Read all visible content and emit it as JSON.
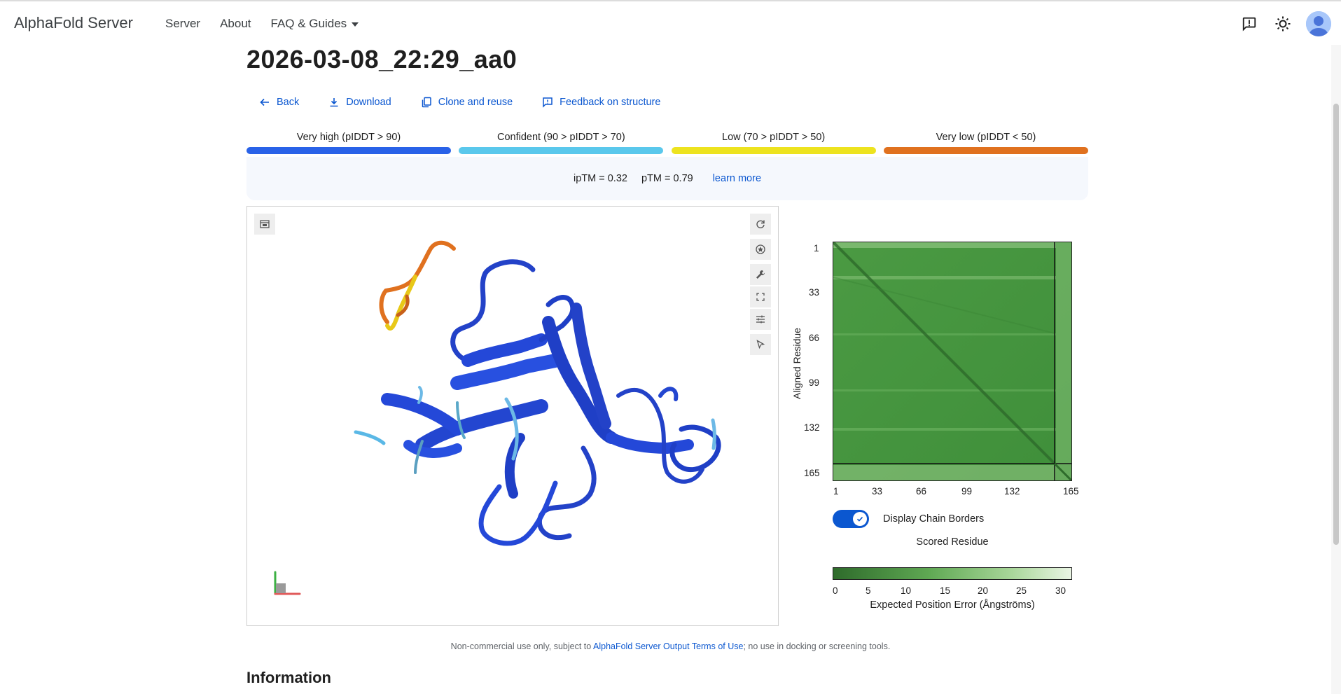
{
  "app": {
    "brand": "AlphaFold Server"
  },
  "nav": {
    "server": "Server",
    "about": "About",
    "faq": "FAQ & Guides"
  },
  "icons": {
    "feedback": "feedback-icon",
    "theme": "brightness-icon",
    "avatar": "account-avatar"
  },
  "page": {
    "title": "2026-03-08_22:29_aa0"
  },
  "actions": {
    "back": "Back",
    "download": "Download",
    "clone": "Clone and reuse",
    "feedback": "Feedback on structure"
  },
  "legend": [
    {
      "label": "Very high (pIDDT > 90)",
      "color": "#2962e8"
    },
    {
      "label": "Confident (90 > pIDDT > 70)",
      "color": "#5ac8ec"
    },
    {
      "label": "Low (70 > pIDDT > 50)",
      "color": "#ede31f"
    },
    {
      "label": "Very low (pIDDT < 50)",
      "color": "#e0711f"
    }
  ],
  "metrics": {
    "iptm": "ipTM = 0.32",
    "ptm": "pTM = 0.79",
    "learn_more": "learn more"
  },
  "pae": {
    "y_label": "Aligned Residue",
    "x_label": "Scored Residue",
    "ticks": [
      "1",
      "33",
      "66",
      "99",
      "132",
      "165"
    ],
    "chain_borders_label": "Display Chain Borders",
    "chain_borders_on": true,
    "colorbar_ticks": [
      "0",
      "5",
      "10",
      "15",
      "20",
      "25",
      "30"
    ],
    "colorbar_label": "Expected Position Error (Ångströms)"
  },
  "footer": {
    "prefix": "Non-commercial use only, subject to ",
    "link": "AlphaFold Server Output Terms of Use",
    "suffix": "; no use in docking or screening tools."
  },
  "info": {
    "heading": "Information"
  }
}
